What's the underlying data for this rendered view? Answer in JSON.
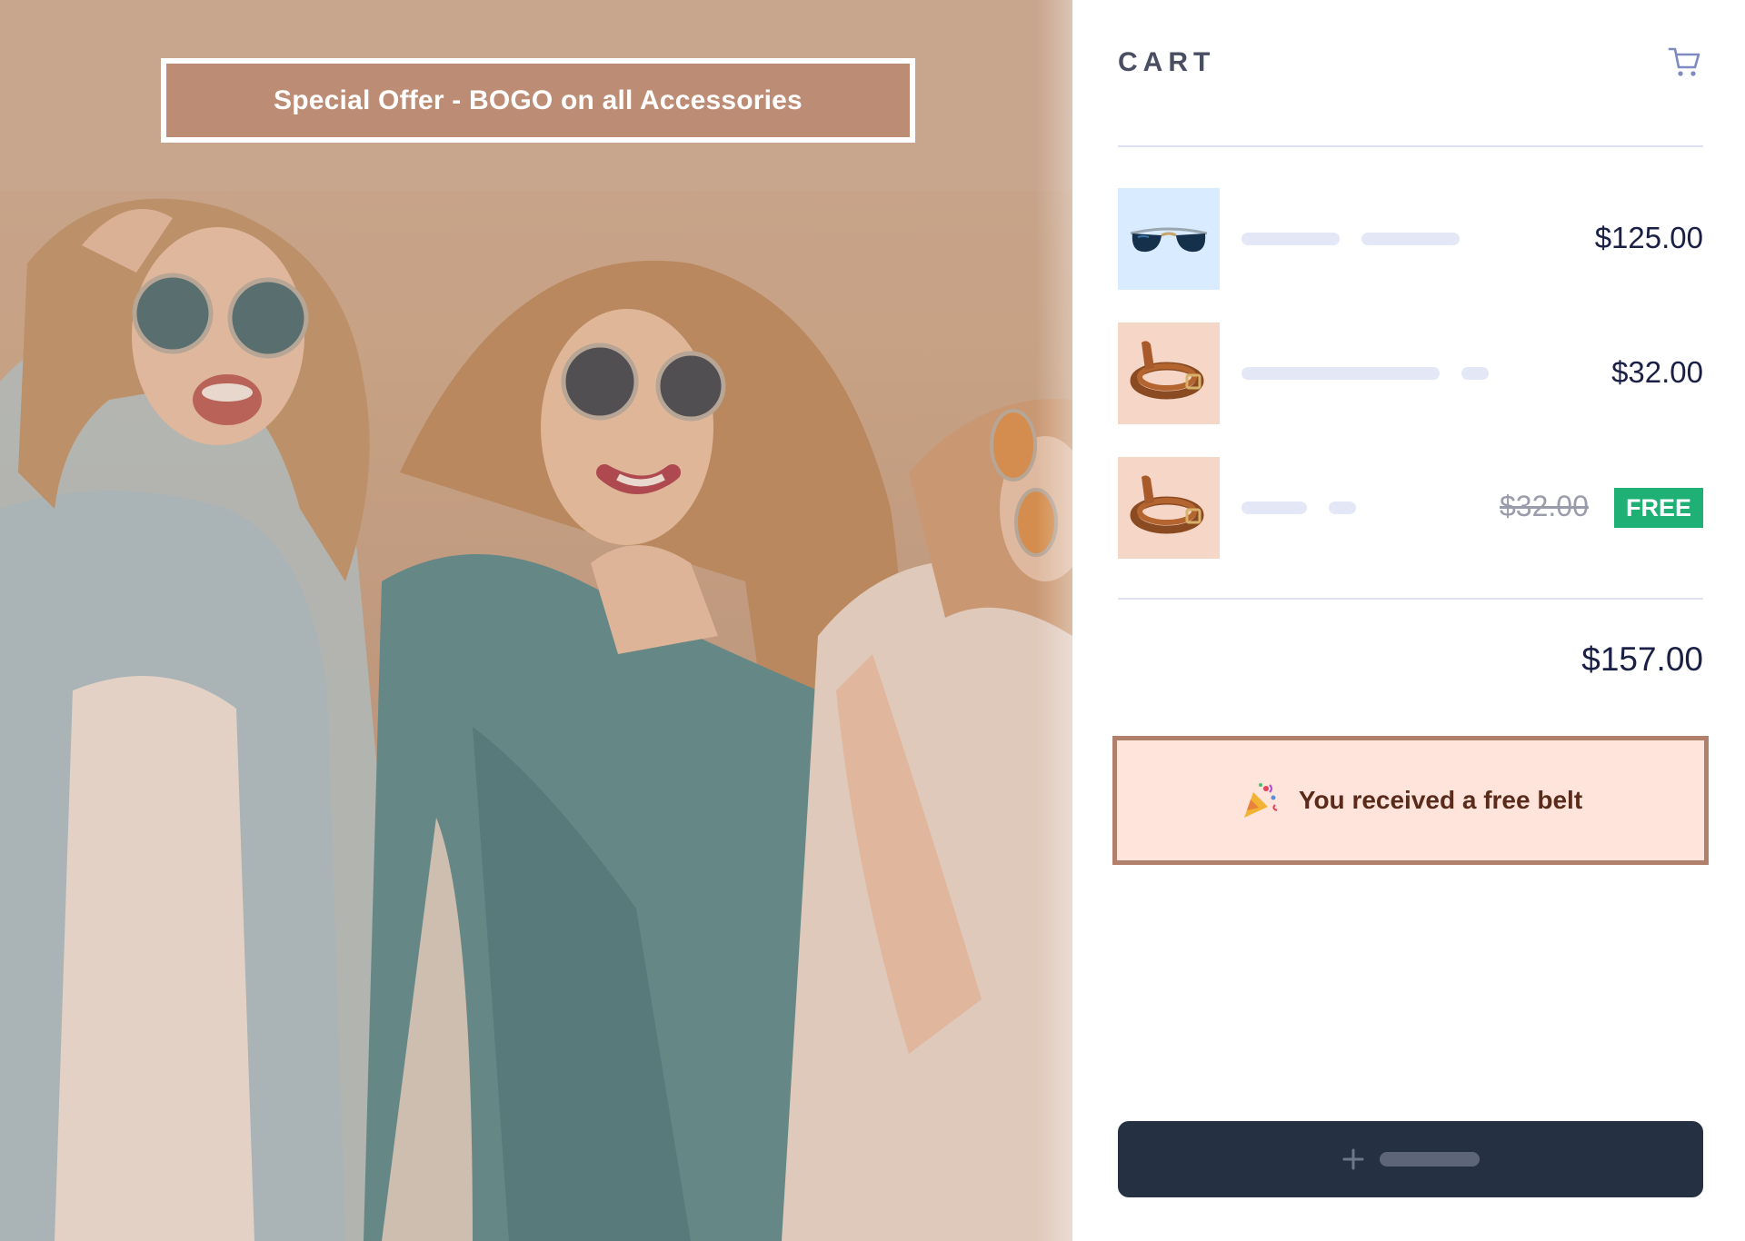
{
  "promo": {
    "banner_text": "Special Offer  - BOGO on all Accessories"
  },
  "cart": {
    "title": "CART",
    "cart_icon": "cart-icon",
    "items": [
      {
        "name": "sunglasses",
        "price": "$125.00"
      },
      {
        "name": "belt",
        "price": "$32.00"
      },
      {
        "name": "belt",
        "original_price": "$32.00",
        "badge": "FREE"
      }
    ],
    "total": "$157.00",
    "notice": {
      "icon": "party-popper-icon",
      "text": "You received a free belt"
    },
    "add_button": {
      "icon": "plus-icon"
    }
  },
  "colors": {
    "accent_dark": "#253042",
    "free_badge": "#1fb076",
    "notice_bg": "#fee4da",
    "notice_border": "#b0806a",
    "banner_bg": "#bd8c74"
  }
}
